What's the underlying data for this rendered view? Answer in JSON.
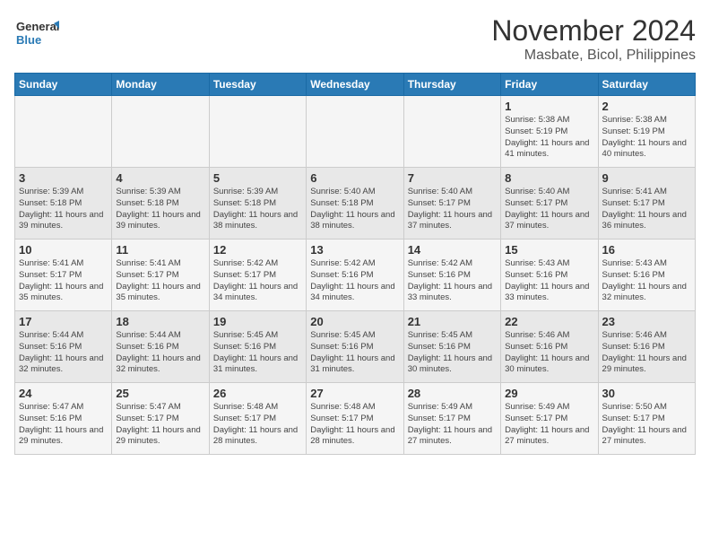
{
  "logo": {
    "line1": "General",
    "line2": "Blue"
  },
  "title": "November 2024",
  "subtitle": "Masbate, Bicol, Philippines",
  "weekdays": [
    "Sunday",
    "Monday",
    "Tuesday",
    "Wednesday",
    "Thursday",
    "Friday",
    "Saturday"
  ],
  "weeks": [
    [
      {
        "day": "",
        "info": ""
      },
      {
        "day": "",
        "info": ""
      },
      {
        "day": "",
        "info": ""
      },
      {
        "day": "",
        "info": ""
      },
      {
        "day": "",
        "info": ""
      },
      {
        "day": "1",
        "info": "Sunrise: 5:38 AM\nSunset: 5:19 PM\nDaylight: 11 hours and 41 minutes."
      },
      {
        "day": "2",
        "info": "Sunrise: 5:38 AM\nSunset: 5:19 PM\nDaylight: 11 hours and 40 minutes."
      }
    ],
    [
      {
        "day": "3",
        "info": "Sunrise: 5:39 AM\nSunset: 5:18 PM\nDaylight: 11 hours and 39 minutes."
      },
      {
        "day": "4",
        "info": "Sunrise: 5:39 AM\nSunset: 5:18 PM\nDaylight: 11 hours and 39 minutes."
      },
      {
        "day": "5",
        "info": "Sunrise: 5:39 AM\nSunset: 5:18 PM\nDaylight: 11 hours and 38 minutes."
      },
      {
        "day": "6",
        "info": "Sunrise: 5:40 AM\nSunset: 5:18 PM\nDaylight: 11 hours and 38 minutes."
      },
      {
        "day": "7",
        "info": "Sunrise: 5:40 AM\nSunset: 5:17 PM\nDaylight: 11 hours and 37 minutes."
      },
      {
        "day": "8",
        "info": "Sunrise: 5:40 AM\nSunset: 5:17 PM\nDaylight: 11 hours and 37 minutes."
      },
      {
        "day": "9",
        "info": "Sunrise: 5:41 AM\nSunset: 5:17 PM\nDaylight: 11 hours and 36 minutes."
      }
    ],
    [
      {
        "day": "10",
        "info": "Sunrise: 5:41 AM\nSunset: 5:17 PM\nDaylight: 11 hours and 35 minutes."
      },
      {
        "day": "11",
        "info": "Sunrise: 5:41 AM\nSunset: 5:17 PM\nDaylight: 11 hours and 35 minutes."
      },
      {
        "day": "12",
        "info": "Sunrise: 5:42 AM\nSunset: 5:17 PM\nDaylight: 11 hours and 34 minutes."
      },
      {
        "day": "13",
        "info": "Sunrise: 5:42 AM\nSunset: 5:16 PM\nDaylight: 11 hours and 34 minutes."
      },
      {
        "day": "14",
        "info": "Sunrise: 5:42 AM\nSunset: 5:16 PM\nDaylight: 11 hours and 33 minutes."
      },
      {
        "day": "15",
        "info": "Sunrise: 5:43 AM\nSunset: 5:16 PM\nDaylight: 11 hours and 33 minutes."
      },
      {
        "day": "16",
        "info": "Sunrise: 5:43 AM\nSunset: 5:16 PM\nDaylight: 11 hours and 32 minutes."
      }
    ],
    [
      {
        "day": "17",
        "info": "Sunrise: 5:44 AM\nSunset: 5:16 PM\nDaylight: 11 hours and 32 minutes."
      },
      {
        "day": "18",
        "info": "Sunrise: 5:44 AM\nSunset: 5:16 PM\nDaylight: 11 hours and 32 minutes."
      },
      {
        "day": "19",
        "info": "Sunrise: 5:45 AM\nSunset: 5:16 PM\nDaylight: 11 hours and 31 minutes."
      },
      {
        "day": "20",
        "info": "Sunrise: 5:45 AM\nSunset: 5:16 PM\nDaylight: 11 hours and 31 minutes."
      },
      {
        "day": "21",
        "info": "Sunrise: 5:45 AM\nSunset: 5:16 PM\nDaylight: 11 hours and 30 minutes."
      },
      {
        "day": "22",
        "info": "Sunrise: 5:46 AM\nSunset: 5:16 PM\nDaylight: 11 hours and 30 minutes."
      },
      {
        "day": "23",
        "info": "Sunrise: 5:46 AM\nSunset: 5:16 PM\nDaylight: 11 hours and 29 minutes."
      }
    ],
    [
      {
        "day": "24",
        "info": "Sunrise: 5:47 AM\nSunset: 5:16 PM\nDaylight: 11 hours and 29 minutes."
      },
      {
        "day": "25",
        "info": "Sunrise: 5:47 AM\nSunset: 5:17 PM\nDaylight: 11 hours and 29 minutes."
      },
      {
        "day": "26",
        "info": "Sunrise: 5:48 AM\nSunset: 5:17 PM\nDaylight: 11 hours and 28 minutes."
      },
      {
        "day": "27",
        "info": "Sunrise: 5:48 AM\nSunset: 5:17 PM\nDaylight: 11 hours and 28 minutes."
      },
      {
        "day": "28",
        "info": "Sunrise: 5:49 AM\nSunset: 5:17 PM\nDaylight: 11 hours and 27 minutes."
      },
      {
        "day": "29",
        "info": "Sunrise: 5:49 AM\nSunset: 5:17 PM\nDaylight: 11 hours and 27 minutes."
      },
      {
        "day": "30",
        "info": "Sunrise: 5:50 AM\nSunset: 5:17 PM\nDaylight: 11 hours and 27 minutes."
      }
    ]
  ]
}
